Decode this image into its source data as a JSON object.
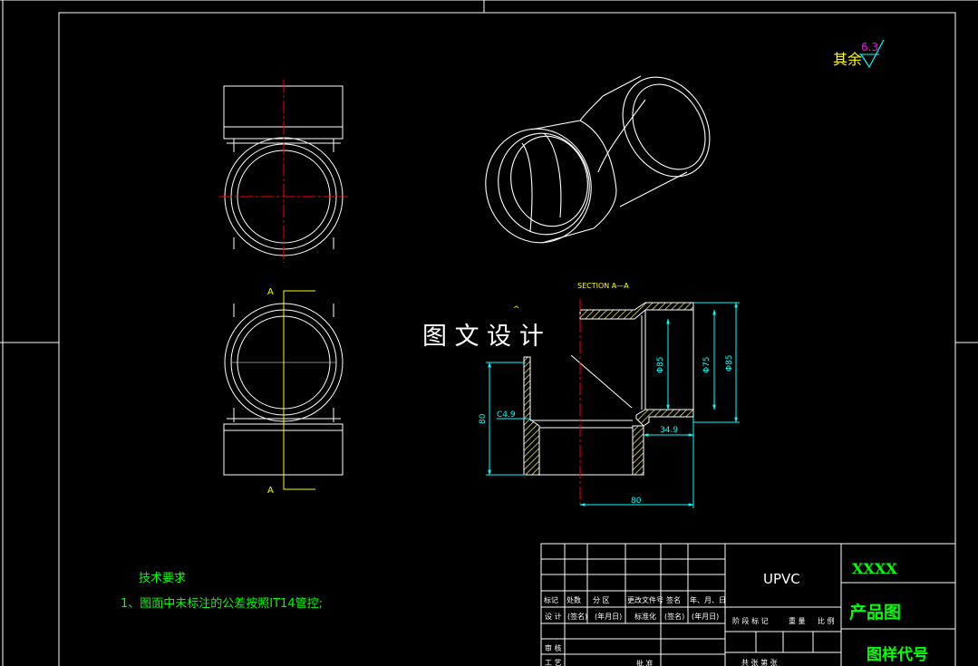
{
  "colors": {
    "background": "#000000",
    "line": "#ffffff",
    "center": "#ff0000",
    "section_line": "#ffff00",
    "dimension": "#00ffff",
    "hatch": "#ffff80",
    "label": "#ffff00",
    "text_green": "#00ff00",
    "roughness_value": "#ff00ff",
    "watermark": "#ffffff"
  },
  "roughness": {
    "prefix": "其余",
    "value": "6.3"
  },
  "section_view": {
    "marker_top": "A",
    "marker_bottom": "A",
    "title": "SECTION  A—A",
    "caret": "^"
  },
  "dimensions": {
    "d85_inner": "Φ85",
    "d75": "Φ75",
    "d85_outer": "Φ85",
    "chamfer": "C4.9",
    "height": "80",
    "width": "80",
    "offset": "34.9"
  },
  "watermark": "图 文 设 计",
  "tech_requirements": {
    "heading": "技术要求",
    "items": [
      "1、图面中未标注的公差按照IT14管控;"
    ]
  },
  "title_block": {
    "headers": [
      "标记",
      "处数",
      "分 区",
      "更改文件号",
      "签名",
      "年、月、日"
    ],
    "row_design": [
      "设 计",
      "(签名)",
      "(年月日)",
      "标准化",
      "(签名)",
      "(年月日)"
    ],
    "stage_labels": [
      "阶 段 标 记",
      "重 量",
      "比 例"
    ],
    "row_review": "审 核",
    "row_process": "工 艺",
    "approve": "批 准",
    "bottom_labels": "共  张  第  张",
    "material": "UPVC",
    "company": "XXXX",
    "drawing_name": "产品图",
    "drawing_code_label": "图样代号"
  }
}
